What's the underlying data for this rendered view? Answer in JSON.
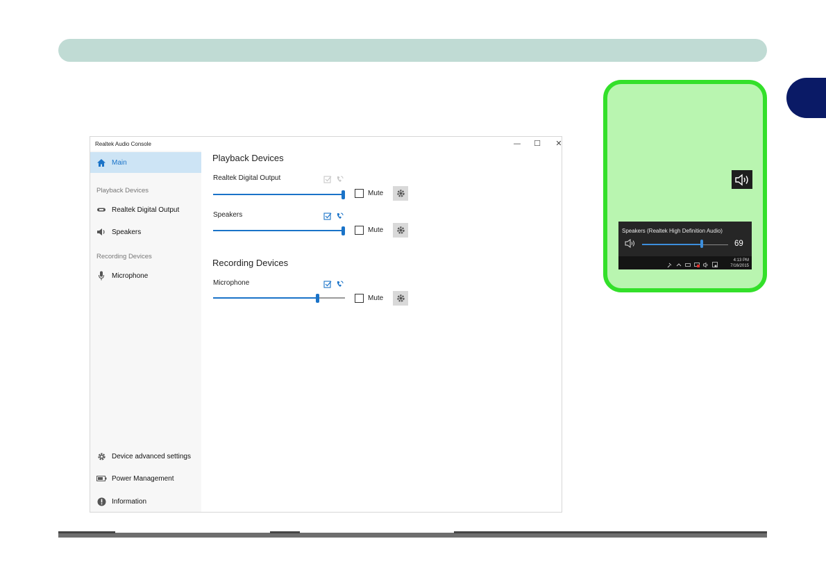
{
  "window": {
    "title": "Realtek Audio Console",
    "controls": {
      "minimize": "—",
      "maximize": "☐",
      "close": "✕"
    }
  },
  "sidebar": {
    "main_label": "Main",
    "playback_section": "Playback Devices",
    "playback_items": [
      "Realtek Digital Output",
      "Speakers"
    ],
    "recording_section": "Recording Devices",
    "recording_items": [
      "Microphone"
    ],
    "bottom_items": [
      "Device advanced settings",
      "Power Management",
      "Information"
    ]
  },
  "content": {
    "playback_heading": "Playback Devices",
    "recording_heading": "Recording Devices",
    "devices": [
      {
        "name": "Realtek Digital Output",
        "level": 1.0,
        "icons_active": false,
        "mute_label": "Mute",
        "muted": false
      },
      {
        "name": "Speakers",
        "level": 1.0,
        "icons_active": true,
        "mute_label": "Mute",
        "muted": false
      },
      {
        "name": "Microphone",
        "level": 0.8,
        "icons_active": true,
        "mute_label": "Mute",
        "muted": false
      }
    ]
  },
  "popup": {
    "title": "Speakers (Realtek High Definition Audio)",
    "volume": "69",
    "volume_level": 0.69,
    "time": "4:13 PM",
    "date": "7/16/2015"
  },
  "colors": {
    "accent": "#1a73c8",
    "header_bar": "#c0dbd4",
    "chapter_tab": "#0a1a66",
    "callout_fill": "#b9f5b0",
    "callout_border": "#33e02a"
  }
}
